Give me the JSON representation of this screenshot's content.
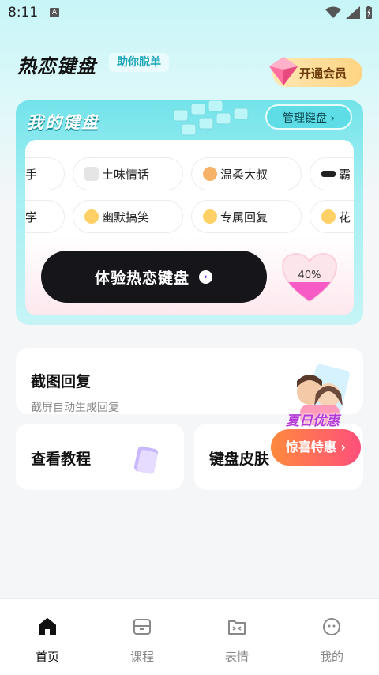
{
  "status_bar": {
    "time": "8:11"
  },
  "header": {
    "title": "热恋键盘",
    "assist_label": "助你脱单",
    "vip_label": "开通会员"
  },
  "keyboard_card": {
    "title": "我的键盘",
    "manage_label": "管理键盘 ›",
    "row1": [
      {
        "emoji_icon": "",
        "label": "高手"
      },
      {
        "emoji_icon": "speech-bubble-icon",
        "label": "土味情话"
      },
      {
        "emoji_icon": "man-face-icon",
        "label": "温柔大叔"
      },
      {
        "emoji_icon": "sunglasses-icon",
        "label": "霸"
      }
    ],
    "row2": [
      {
        "emoji_icon": "",
        "label": "文学"
      },
      {
        "emoji_icon": "tongue-face-icon",
        "label": "幽默搞笑"
      },
      {
        "emoji_icon": "grin-face-icon",
        "label": "专属回复"
      },
      {
        "emoji_icon": "kiss-face-icon",
        "label": "花"
      }
    ],
    "try_label": "体验热恋键盘",
    "progress_percent": "40%"
  },
  "screenshot_reply": {
    "title": "截图回复",
    "subtitle": "截屏自动生成回复"
  },
  "tutorial": {
    "title": "查看教程"
  },
  "skin": {
    "title": "键盘皮肤"
  },
  "promo": {
    "headline": "夏日优惠",
    "button_label": "惊喜特惠 ›"
  },
  "nav": [
    {
      "label": "首页",
      "icon": "home-icon",
      "active": true
    },
    {
      "label": "课程",
      "icon": "course-box-icon",
      "active": false
    },
    {
      "label": "表情",
      "icon": "emoji-folder-icon",
      "active": false
    },
    {
      "label": "我的",
      "icon": "face-icon",
      "active": false
    }
  ],
  "colors": {
    "accent": "#5edde6",
    "dark_button": "#16151a",
    "promo_start": "#ff8a3d",
    "promo_end": "#ff4f7b",
    "vip": "#ffd482"
  }
}
